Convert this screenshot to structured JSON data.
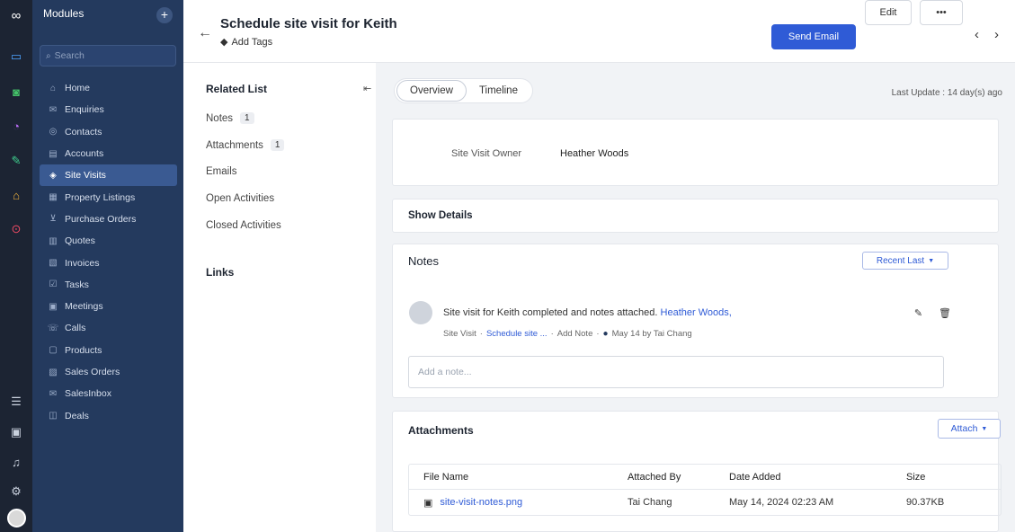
{
  "colors": {
    "rail": "#1c2433",
    "sidebar": "#243a5e",
    "active": "#3a5a92",
    "primary": "#2f5bd6"
  },
  "rail_icons": [
    {
      "icon": "app-logo-icon",
      "color": "#ffffff"
    },
    {
      "icon": "folder-icon",
      "color": "#4da3ff"
    },
    {
      "icon": "analytics-icon",
      "color": "#45c46a"
    },
    {
      "icon": "pie-chart-icon",
      "color": "#b86cf5"
    },
    {
      "icon": "edit-doc-icon",
      "color": "#3fcf8e"
    },
    {
      "icon": "store-icon",
      "color": "#f5b53d"
    },
    {
      "icon": "search-icon",
      "color": "#ef4a64"
    },
    {
      "icon": "notes-icon",
      "color": "#c9d1de"
    },
    {
      "icon": "calendar-icon",
      "color": "#c9d1de"
    },
    {
      "icon": "bell-icon",
      "color": "#c9d1de"
    },
    {
      "icon": "settings-icon",
      "color": "#c9d1de"
    }
  ],
  "sidebar": {
    "title": "Modules",
    "search_placeholder": "Search",
    "items": [
      {
        "label": "Home",
        "icon": "home-icon"
      },
      {
        "label": "Enquiries",
        "icon": "enquiries-icon"
      },
      {
        "label": "Contacts",
        "icon": "contacts-icon"
      },
      {
        "label": "Accounts",
        "icon": "accounts-icon"
      },
      {
        "label": "Site Visits",
        "icon": "site-visits-icon",
        "active": true
      },
      {
        "label": "Property Listings",
        "icon": "property-listings-icon"
      },
      {
        "label": "Purchase Orders",
        "icon": "purchase-orders-icon"
      },
      {
        "label": "Quotes",
        "icon": "quotes-icon"
      },
      {
        "label": "Invoices",
        "icon": "invoices-icon"
      },
      {
        "label": "Tasks",
        "icon": "tasks-icon"
      },
      {
        "label": "Meetings",
        "icon": "meetings-icon"
      },
      {
        "label": "Calls",
        "icon": "calls-icon"
      },
      {
        "label": "Products",
        "icon": "products-icon"
      },
      {
        "label": "Sales Orders",
        "icon": "sales-orders-icon"
      },
      {
        "label": "SalesInbox",
        "icon": "salesinbox-icon"
      },
      {
        "label": "Deals",
        "icon": "deals-icon"
      }
    ]
  },
  "header": {
    "title": "Schedule site visit for Keith",
    "add_tags": "Add Tags",
    "send_email": "Send Email",
    "edit": "Edit",
    "more": "•••"
  },
  "related": {
    "title": "Related List",
    "items": [
      {
        "label": "Notes",
        "count": "1"
      },
      {
        "label": "Attachments",
        "count": "1"
      },
      {
        "label": "Emails",
        "count": ""
      },
      {
        "label": "Open Activities",
        "count": ""
      },
      {
        "label": "Closed Activities",
        "count": ""
      }
    ],
    "links": "Links"
  },
  "main": {
    "tabs": [
      {
        "label": "Overview",
        "active": true
      },
      {
        "label": "Timeline",
        "active": false
      }
    ],
    "last_update": "Last Update : 14 day(s) ago",
    "owner_label": "Site Visit Owner",
    "owner_value": "Heather Woods",
    "show_details": "Show Details",
    "notes": {
      "title": "Notes",
      "sort": "Recent Last",
      "note_text": "Site visit for Keith completed and notes attached.",
      "note_mention": "Heather Woods,",
      "meta_module": "Site Visit",
      "meta_record": "Schedule site ...",
      "meta_add_note": "Add Note",
      "meta_time": "May 14 by Tai Chang",
      "input_placeholder": "Add a note..."
    },
    "attachments": {
      "title": "Attachments",
      "attach_button": "Attach",
      "columns": [
        "File Name",
        "Attached By",
        "Date Added",
        "Size"
      ],
      "rows": [
        {
          "file": "site-visit-notes.png",
          "by": "Tai Chang",
          "date": "May 14, 2024 02:23 AM",
          "size": "90.37KB"
        }
      ]
    }
  }
}
